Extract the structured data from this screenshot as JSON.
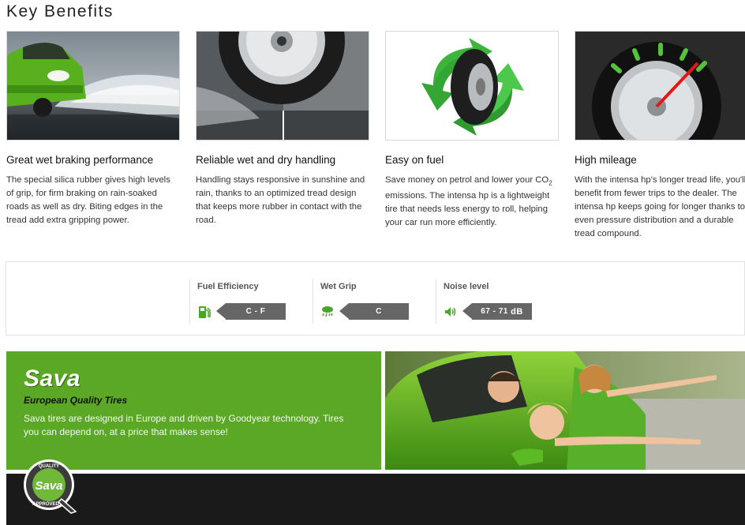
{
  "page": {
    "title": "Key Benefits"
  },
  "benefits": [
    {
      "title": "Great wet braking performance",
      "text": "The special silica rubber gives high levels of grip, for firm braking on rain-soaked roads as well as dry. Biting edges in the tread add extra gripping power.",
      "image": "car-wet-road-image"
    },
    {
      "title": "Reliable wet and dry handling",
      "text": "Handling stays responsive in sunshine and rain, thanks to an optimized tread design that keeps more rubber in contact with the road.",
      "image": "tire-wet-dry-image"
    },
    {
      "title": "Easy on fuel",
      "text_before": "Save money on petrol and lower your CO",
      "text_sub": "2",
      "text_after": " emissions. The intensa hp is a lightweight tire that needs less energy to roll, helping your car run more efficiently.",
      "image": "tire-recycle-arrows-image"
    },
    {
      "title": "High mileage",
      "text": "With the intensa hp's longer tread life, you'll benefit from fewer trips to the dealer. The intensa hp keeps going for longer thanks to even pressure distribution and a durable tread compound.",
      "image": "tire-gauge-image"
    }
  ],
  "eu_label": {
    "fuel": {
      "label": "Fuel Efficiency",
      "value": "C - F",
      "icon": "fuel-pump-icon"
    },
    "wet": {
      "label": "Wet Grip",
      "value": "C",
      "icon": "rain-cloud-icon"
    },
    "noise": {
      "label": "Noise level",
      "value": "67 - 71",
      "unit": "dB",
      "icon": "speaker-icon"
    }
  },
  "promo": {
    "brand": "Sava",
    "tagline": "European Quality Tires",
    "description": "Sava tires are designed in Europe and driven by Goodyear technology. Tires you can depend on, at a price that makes sense!"
  },
  "seal": {
    "top_text": "QUALITY",
    "brand": "Sava",
    "bottom_text": "APPROVED"
  },
  "colors": {
    "brand_green": "#5aa825",
    "tag_gray": "#666666",
    "footer": "#1a1a1a"
  }
}
